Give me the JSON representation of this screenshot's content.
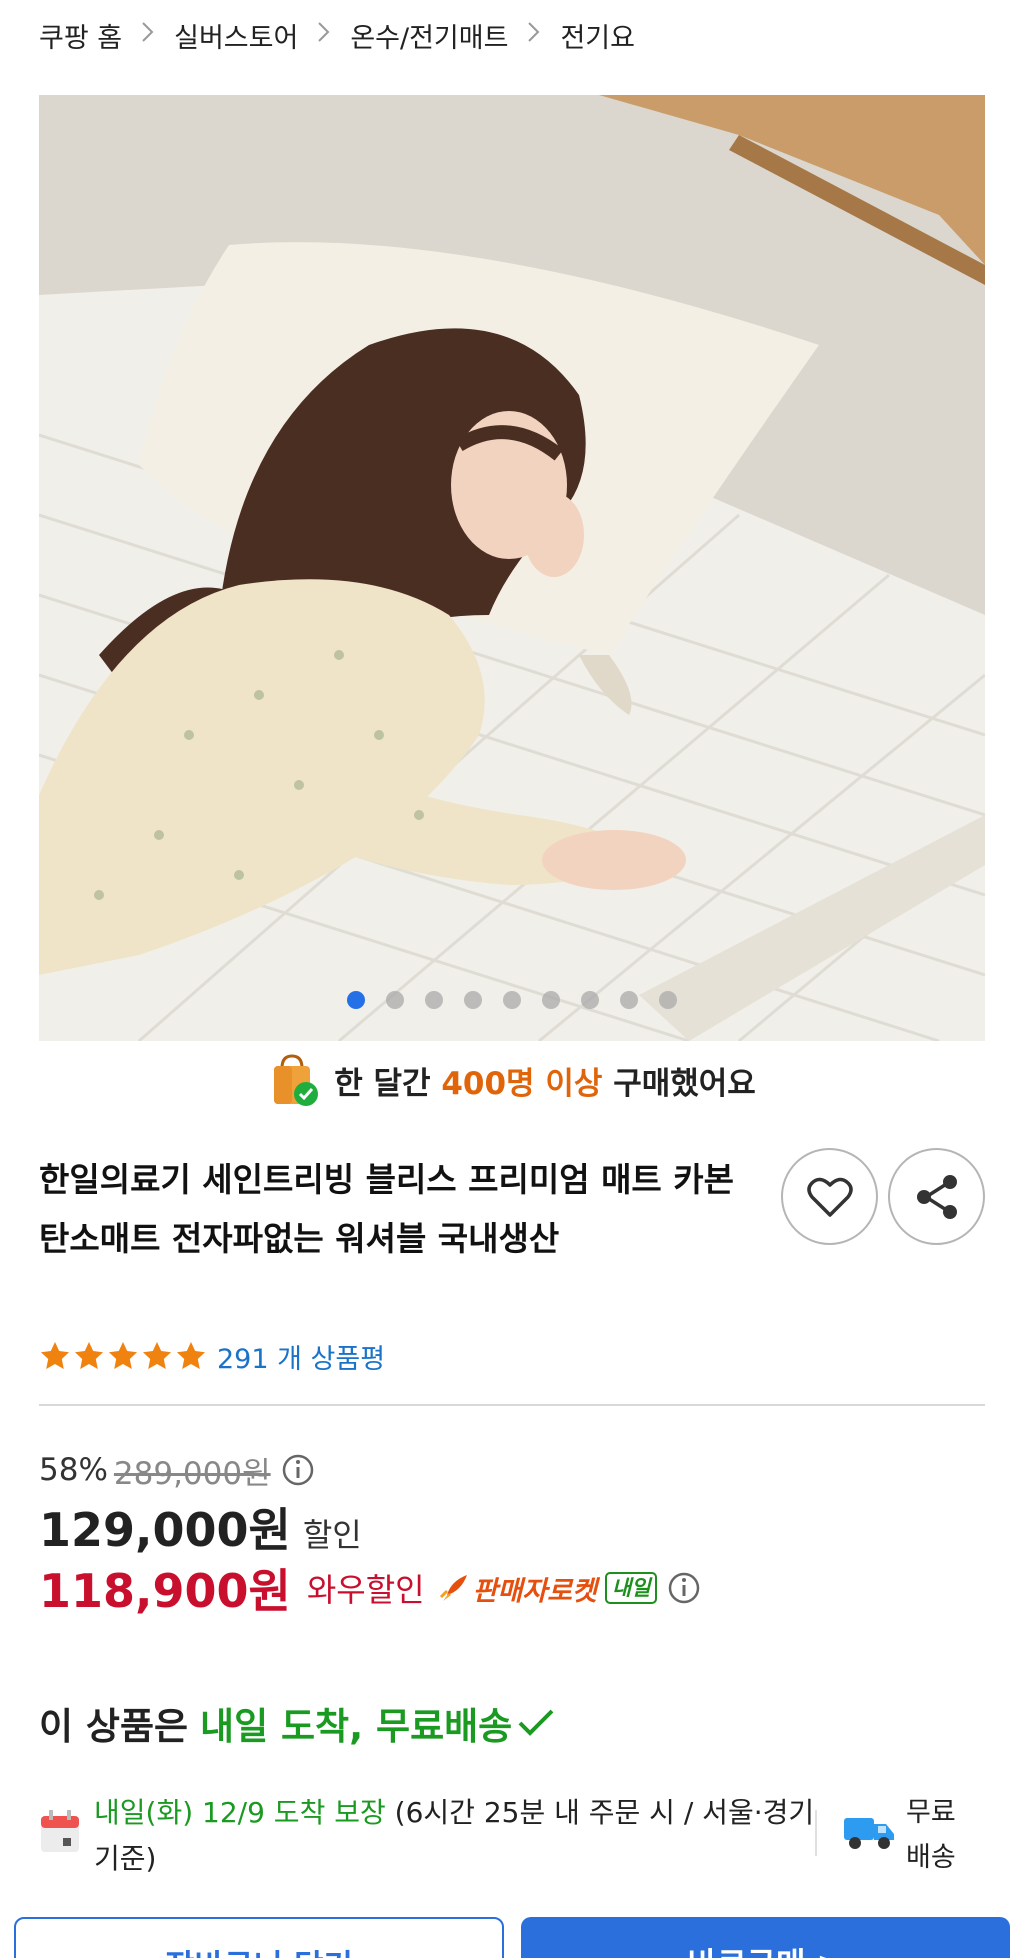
{
  "breadcrumb": {
    "items": [
      "쿠팡 홈",
      "실버스토어",
      "온수/전기매트",
      "전기요"
    ],
    "separator": ">"
  },
  "gallery": {
    "slide_count": 9,
    "active_slide": 1
  },
  "purchase_notice": {
    "prefix": "한 달간",
    "highlight": "400명 이상",
    "suffix": "구매했어요"
  },
  "product": {
    "title": "한일의료기 세인트리빙 블리스 프리미엄 매트 카본 탄소매트 전자파없는 워셔블 국내생산",
    "rating_stars": 5,
    "review_count": "291 개 상품평"
  },
  "price": {
    "discount_rate": "58%",
    "original": "289,000원",
    "sale": "129,000원",
    "sale_label": "할인",
    "wow": "118,900원",
    "wow_label": "와우할인",
    "rocket_label": "판매자로켓",
    "tomorrow_badge": "내일"
  },
  "delivery": {
    "heading_prefix": "이 상품은",
    "heading_highlight": "내일 도착, 무료배송",
    "date": "내일(화) 12/9 도착 보장",
    "condition": "(6시간 25분 내 주문 시 / 서울·경기 기준)",
    "free_shipping": "무료 배송"
  },
  "buttons": {
    "cart": "장바구니 담기",
    "buy": "바로구매 >"
  },
  "colors": {
    "accent_blue": "#2a6fdb",
    "price_red": "#c8102e",
    "delivery_green": "#1b9a22",
    "notice_orange": "#e0650a",
    "star_orange": "#f0820f"
  },
  "icons": [
    "chevron-right-icon",
    "shopping-bag-check-icon",
    "heart-icon",
    "share-icon",
    "star-icon",
    "info-icon",
    "rocket-icon",
    "checkmark-icon",
    "calendar-icon",
    "truck-icon"
  ]
}
